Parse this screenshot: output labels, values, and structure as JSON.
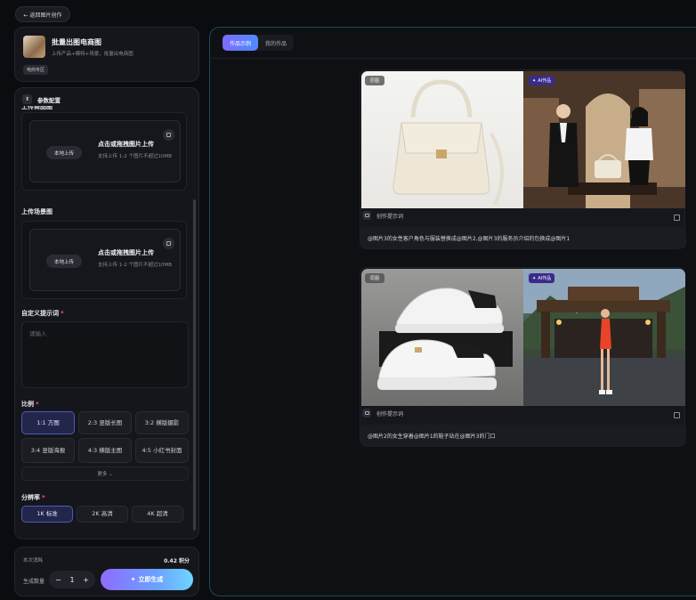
{
  "back_label": "← 返回图片创作",
  "app": {
    "title": "批量出图电商图",
    "subtitle": "上传产品+模特+场景，批量出电商图",
    "badge": "电商专区"
  },
  "params": {
    "header": "参数配置",
    "cut_label": "上传商品图",
    "upload1": {
      "local_btn": "本地上传",
      "title": "点击或拖拽图片上传",
      "hint": "支持上传 1-2 个图片不超过10MB"
    },
    "scene_label": "上传场景图",
    "upload2": {
      "local_btn": "本地上传",
      "title": "点击或拖拽图片上传",
      "hint": "支持上传 1-2 个图片不超过10MB"
    },
    "prompt_label": "自定义提示词",
    "prompt_placeholder": "请输入",
    "ratio_label": "比例",
    "ratios": [
      "1:1 方图",
      "2:3 竖版长图",
      "3:2 横版摄影",
      "3:4 竖版海报",
      "4:3 横版主图",
      "4:5 小红书封面"
    ],
    "more_label": "更多 ⌄",
    "res_label": "分辨率",
    "resolutions": [
      "1K 标准",
      "2K 高清",
      "4K 超清"
    ],
    "required_mark": "*"
  },
  "footer": {
    "cost_label": "本次消耗",
    "cost_value": "0.42 积分",
    "qty_label": "生成数量",
    "qty_minus": "−",
    "qty_value": "1",
    "qty_plus": "+",
    "generate_label": "立即生成"
  },
  "tabs": [
    "作品示例",
    "我的作品"
  ],
  "works": [
    {
      "orig_tag": "原图",
      "ai_tag": "AI作品",
      "prompt_head": "创作提示词",
      "prompt": "@图片3的女性客户角色与服装替换成@图片2,@图片3的服务员介绍的包换成@图片1"
    },
    {
      "orig_tag": "原图",
      "ai_tag": "AI作品",
      "prompt_head": "创作提示词",
      "prompt": "@图片2的女生穿着@图片1的鞋子站在@图片3的门口"
    }
  ],
  "colors": {
    "accent": "#6a8dff",
    "panel_border": "#1e4a52"
  }
}
